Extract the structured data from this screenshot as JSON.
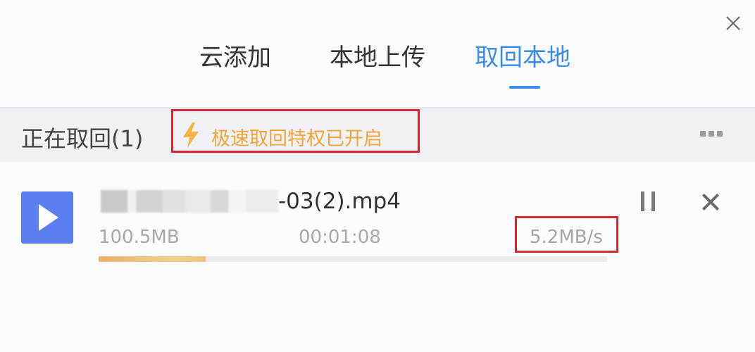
{
  "tabs": [
    {
      "label": "云添加",
      "active": false
    },
    {
      "label": "本地上传",
      "active": false
    },
    {
      "label": "取回本地",
      "active": true
    }
  ],
  "section": {
    "title": "正在取回(1)",
    "privilege_text": "极速取回特权已开启"
  },
  "download": {
    "file_name_visible": "-03(2).mp4",
    "size": "100.5MB",
    "elapsed_time": "00:01:08",
    "speed": "5.2MB/s",
    "progress_fraction": 0.21
  },
  "icons": {
    "close": "close-icon",
    "bolt": "lightning-bolt-icon",
    "more": "more-options-icon",
    "file": "video-file-icon",
    "pause": "pause-icon",
    "cancel": "cancel-icon"
  },
  "colors": {
    "accent": "#3a8ee6",
    "privilege": "#f0a637",
    "highlight_border": "#d9262c",
    "file_icon": "#5b7ff0"
  }
}
